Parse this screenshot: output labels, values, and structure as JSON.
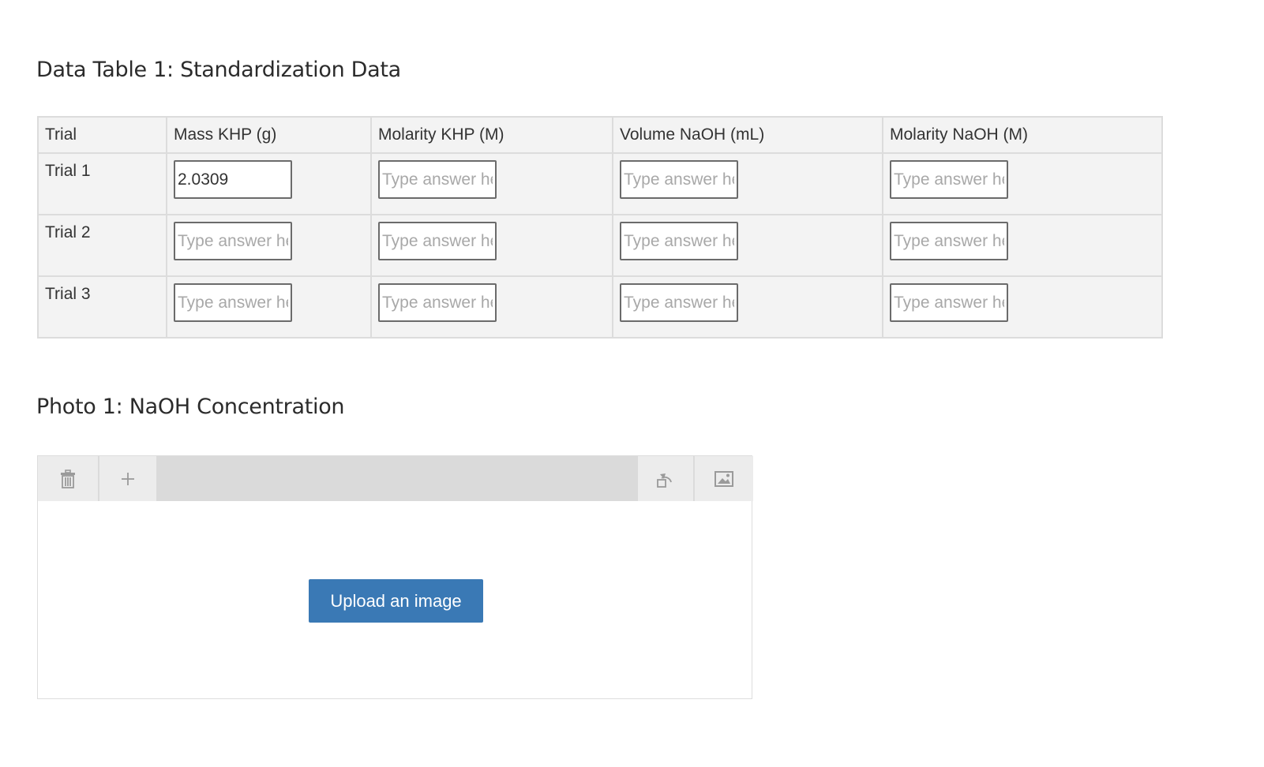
{
  "table_section": {
    "title": "Data Table 1: Standardization Data",
    "headers": [
      "Trial",
      "Mass KHP (g)",
      "Molarity KHP (M)",
      "Volume NaOH (mL)",
      "Molarity NaOH (M)"
    ],
    "placeholder": "Type answer here",
    "rows": [
      {
        "label": "Trial 1",
        "values": [
          "2.0309",
          "",
          "",
          ""
        ]
      },
      {
        "label": "Trial 2",
        "values": [
          "",
          "",
          "",
          ""
        ]
      },
      {
        "label": "Trial 3",
        "values": [
          "",
          "",
          "",
          ""
        ]
      }
    ]
  },
  "photo_section": {
    "title": "Photo 1: NaOH Concentration",
    "toolbar": {
      "left_icons": [
        "trash-icon",
        "plus-icon"
      ],
      "right_icons": [
        "rotate-icon",
        "image-icon"
      ]
    },
    "upload_label": "Upload an image"
  }
}
